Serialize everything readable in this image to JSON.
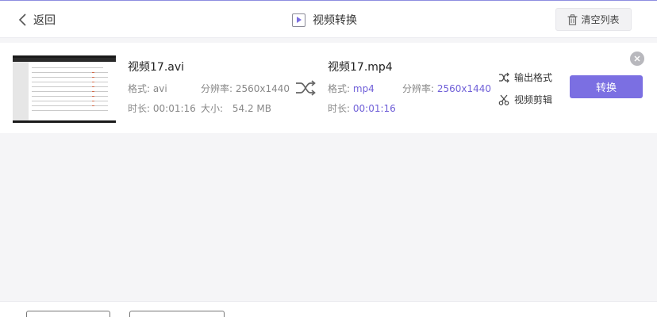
{
  "header": {
    "back_label": "返回",
    "title": "视频转换",
    "clear_label": "清空列表"
  },
  "file": {
    "source": {
      "name": "视频17.avi",
      "format_label": "格式:",
      "format_value": "avi",
      "resolution_label": "分辨率:",
      "resolution_value": "2560x1440",
      "duration_label": "时长:",
      "duration_value": "00:01:16",
      "size_label": "大小:",
      "size_value": "54.2 MB"
    },
    "target": {
      "name": "视频17.mp4",
      "format_label": "格式:",
      "format_value": "mp4",
      "resolution_label": "分辨率:",
      "resolution_value": "2560x1440",
      "duration_label": "时长:",
      "duration_value": "00:01:16"
    },
    "actions": {
      "output_format": "输出格式",
      "video_edit": "视频剪辑",
      "convert": "转换"
    }
  },
  "colors": {
    "accent": "#7b6fe2",
    "accent_text": "#7060d8",
    "header_border": "#8d8de0"
  },
  "icons": {
    "back": "chevron-left-icon",
    "title": "play-icon",
    "clear": "trash-icon",
    "swap": "shuffle-icon",
    "output_format": "shuffle-icon",
    "video_edit": "scissors-icon",
    "remove": "close-icon"
  }
}
